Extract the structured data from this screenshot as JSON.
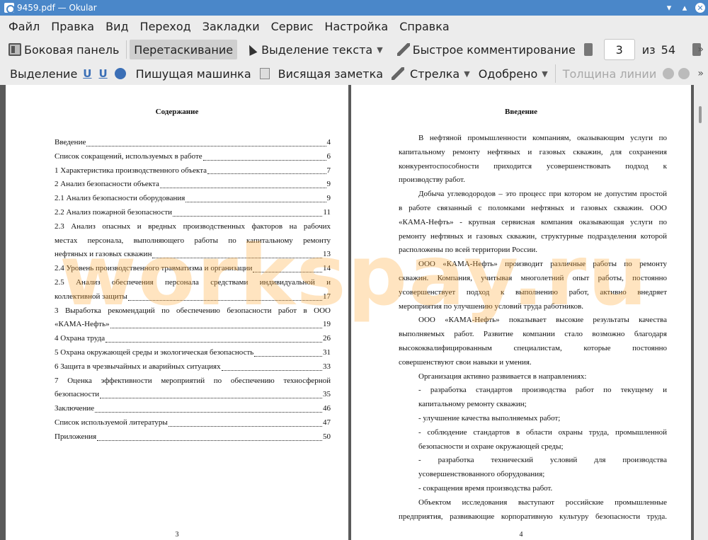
{
  "window": {
    "title": "9459.pdf  — Okular"
  },
  "menubar": {
    "items": [
      "Файл",
      "Правка",
      "Вид",
      "Переход",
      "Закладки",
      "Сервис",
      "Настройка",
      "Справка"
    ]
  },
  "toolbar1": {
    "sidebar_label": "Боковая панель",
    "drag_label": "Перетаскивание",
    "text_select_label": "Выделение текста",
    "quick_comment_label": "Быстрое комментирование",
    "current_page": "3",
    "of_label": "из",
    "total_pages": "54"
  },
  "toolbar2": {
    "highlight_label": "Выделение",
    "underline_a": "U",
    "underline_b": "U",
    "typewriter_label": "Пишущая машинка",
    "sticky_note_label": "Висящая заметка",
    "arrow_label": "Стрелка",
    "approved_label": "Одобрено",
    "line_width_label": "Толщина линии"
  },
  "left_page": {
    "heading": "Содержание",
    "page_number": "3",
    "toc": [
      {
        "text": "Введение",
        "page": "4"
      },
      {
        "text": "Список сокращений, используемых в работе",
        "page": "6"
      },
      {
        "text": "1 Характеристика производственного объекта",
        "page": "7"
      },
      {
        "text": "2 Анализ безопасности объекта",
        "page": "9"
      },
      {
        "text": "2.1 Анализ безопасности оборудования",
        "page": "9"
      },
      {
        "text": "2.2 Анализ пожарной безопасности",
        "page": "11"
      },
      {
        "text_lines": [
          "2.3 Анализ опасных и вредных производственных факторов на рабочих",
          "местах персонала, выполняющего работы по капитальному ремонту"
        ],
        "text": "нефтяных и газовых скважин",
        "page": "13"
      },
      {
        "text": "2.4 Уровень производственного травматизма и организации",
        "page": "14"
      },
      {
        "text_lines": [
          "2.5 Анализ обеспечения персонала средствами индивидуальной и"
        ],
        "text": "коллективной защиты",
        "page": "17"
      },
      {
        "text_lines": [
          "3 Выработка рекомендаций по обеспечению безопасности работ в ООО"
        ],
        "text": "«КАМА-Нефть»",
        "page": "19"
      },
      {
        "text": "4 Охрана труда",
        "page": "26"
      },
      {
        "text": "5 Охрана окружающей среды и экологическая безопасность",
        "page": "31"
      },
      {
        "text": "6 Защита в чрезвычайных и аварийных ситуациях",
        "page": "33"
      },
      {
        "text_lines": [
          "7 Оценка эффективности мероприятий по обеспечению техносферной"
        ],
        "text": "безопасности",
        "page": "35"
      },
      {
        "text": "Заключение",
        "page": "46"
      },
      {
        "text": "Список используемой литературы",
        "page": "47"
      },
      {
        "text": "Приложения",
        "page": "50"
      }
    ]
  },
  "right_page": {
    "heading": "Введение",
    "page_number": "4",
    "lines": [
      {
        "t": "В нефтяной промышленности компаниям, оказывающим услуги по",
        "s": "j ind"
      },
      {
        "t": "капитальному ремонту нефтяных и газовых скважин, для сохранения",
        "s": "j"
      },
      {
        "t": "конкурентоспособности приходится усовершенствовать подход к",
        "s": "j"
      },
      {
        "t": "производству работ.",
        "s": ""
      },
      {
        "t": "Добыча углеводородов – это процесс при котором не допустим простой",
        "s": "j ind"
      },
      {
        "t": "в работе связанный с поломками нефтяных и газовых скважин. ООО",
        "s": "j"
      },
      {
        "t": "«КАМА-Нефть» - крупная сервисная компания оказывающая услуги по",
        "s": "j"
      },
      {
        "t": "ремонту нефтяных и газовых скважин, структурные подразделения которой",
        "s": "j"
      },
      {
        "t": "расположены по всей территории России.",
        "s": ""
      },
      {
        "t": " ООО «КАМА-Нефть» производит различные работы по ремонту",
        "s": "j ind"
      },
      {
        "t": "скважин. Компания, учитывая многолетний опыт работы, постоянно",
        "s": "j"
      },
      {
        "t": "усовершенствует подход к выполнению работ, активно внедряет",
        "s": "j"
      },
      {
        "t": "мероприятия по улучшению условий труда работников.",
        "s": ""
      },
      {
        "t": "ООО «КАМА-Нефть» показывает высокие результаты качества",
        "s": "j ind"
      },
      {
        "t": "выполняемых работ. Развитие компании стало возможно благодаря",
        "s": "j"
      },
      {
        "t": "высококвалифицированным специалистам, которые постоянно",
        "s": "j"
      },
      {
        "t": "совершенствуют свои навыки и умения.",
        "s": ""
      },
      {
        "t": "Организация активно развивается в направлениях:",
        "s": "ind"
      },
      {
        "t": "-      разработка стандартов производства работ по текущему и",
        "s": "j ind"
      },
      {
        "t": "капитальному ремонту скважин;",
        "s": "ind"
      },
      {
        "t": "-   улучшение качества выполняемых работ;",
        "s": "ind"
      },
      {
        "t": "-    соблюдение стандартов в области охраны труда, промышленной",
        "s": "j ind"
      },
      {
        "t": "безопасности и охране окружающей среды;",
        "s": "ind"
      },
      {
        "t": "-     разработка технический условий для производства",
        "s": "j ind"
      },
      {
        "t": "усовершенствованного оборудования;",
        "s": "ind"
      },
      {
        "t": "-   сокращения время производства работ.",
        "s": "ind"
      },
      {
        "t": "Объектом исследования выступают российские промышленные",
        "s": "j ind"
      },
      {
        "t": "предприятия, развивающие корпоративную культуру безопасности труда.",
        "s": "j"
      }
    ]
  },
  "watermark": "workspay.ru"
}
